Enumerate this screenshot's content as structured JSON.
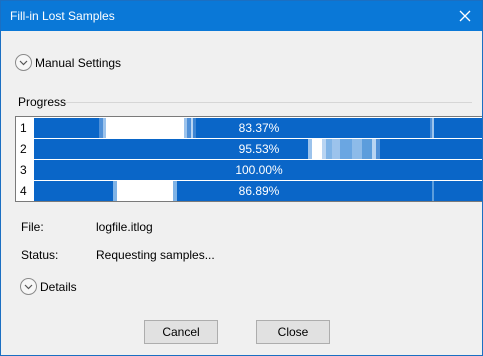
{
  "window": {
    "title": "Fill-in Lost Samples"
  },
  "manual_settings": {
    "label": "Manual Settings"
  },
  "progress": {
    "label": "Progress",
    "rows": [
      {
        "index": "1",
        "text": "83.37%"
      },
      {
        "index": "2",
        "text": "95.53%"
      },
      {
        "index": "3",
        "text": "100.00%"
      },
      {
        "index": "4",
        "text": "86.89%"
      }
    ]
  },
  "file": {
    "label": "File:",
    "value": "logfile.itlog"
  },
  "status": {
    "label": "Status:",
    "value": "Requesting samples..."
  },
  "details": {
    "label": "Details"
  },
  "buttons": {
    "cancel": "Cancel",
    "close": "Close"
  },
  "colors": {
    "titlebar": "#0a78d7",
    "bar": "#0a66c8",
    "light_bar": "#7fb3e6"
  }
}
